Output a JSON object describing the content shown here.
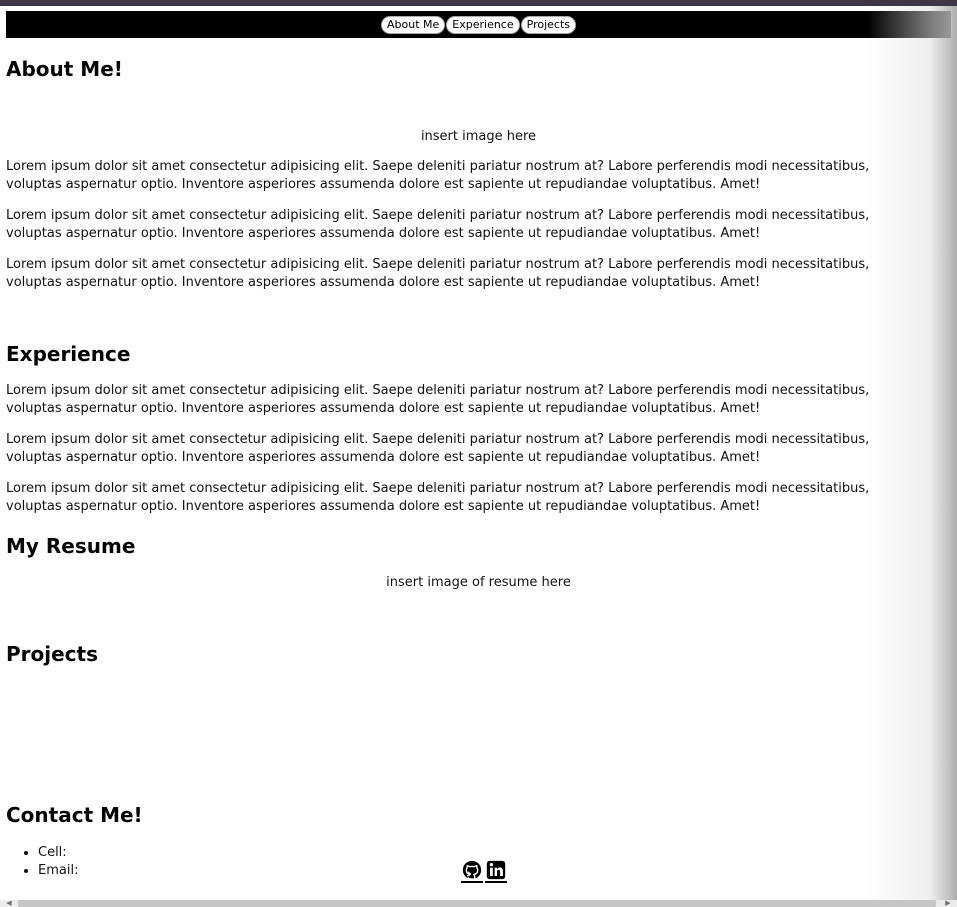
{
  "nav": {
    "links": [
      "About Me",
      "Experience",
      "Projects"
    ]
  },
  "about": {
    "title": "About Me!",
    "image_placeholder": "insert image here",
    "paragraphs": [
      "Lorem ipsum dolor sit amet consectetur adipisicing elit. Saepe deleniti pariatur nostrum at? Labore perferendis modi necessitatibus, voluptas aspernatur optio. Inventore asperiores assumenda dolore est sapiente ut repudiandae voluptatibus. Amet!",
      "Lorem ipsum dolor sit amet consectetur adipisicing elit. Saepe deleniti pariatur nostrum at? Labore perferendis modi necessitatibus, voluptas aspernatur optio. Inventore asperiores assumenda dolore est sapiente ut repudiandae voluptatibus. Amet!",
      "Lorem ipsum dolor sit amet consectetur adipisicing elit. Saepe deleniti pariatur nostrum at? Labore perferendis modi necessitatibus, voluptas aspernatur optio. Inventore asperiores assumenda dolore est sapiente ut repudiandae voluptatibus. Amet!"
    ]
  },
  "experience": {
    "title": "Experience",
    "paragraphs": [
      "Lorem ipsum dolor sit amet consectetur adipisicing elit. Saepe deleniti pariatur nostrum at? Labore perferendis modi necessitatibus, voluptas aspernatur optio. Inventore asperiores assumenda dolore est sapiente ut repudiandae voluptatibus. Amet!",
      "Lorem ipsum dolor sit amet consectetur adipisicing elit. Saepe deleniti pariatur nostrum at? Labore perferendis modi necessitatibus, voluptas aspernatur optio. Inventore asperiores assumenda dolore est sapiente ut repudiandae voluptatibus. Amet!",
      "Lorem ipsum dolor sit amet consectetur adipisicing elit. Saepe deleniti pariatur nostrum at? Labore perferendis modi necessitatibus, voluptas aspernatur optio. Inventore asperiores assumenda dolore est sapiente ut repudiandae voluptatibus. Amet!"
    ]
  },
  "resume": {
    "title": "My Resume",
    "image_placeholder": "insert image of resume here"
  },
  "projects": {
    "title": "Projects"
  },
  "contact": {
    "title": "Contact Me!",
    "items": [
      "Cell:",
      "Email:"
    ],
    "icons": [
      "github-icon",
      "linkedin-icon"
    ]
  },
  "colors": {
    "navbar": "#000000",
    "top_strip": "#3d3744",
    "nav_button": "#ffffff",
    "text": "#111111",
    "scrollbar_thumb": "#c6c6c6"
  }
}
